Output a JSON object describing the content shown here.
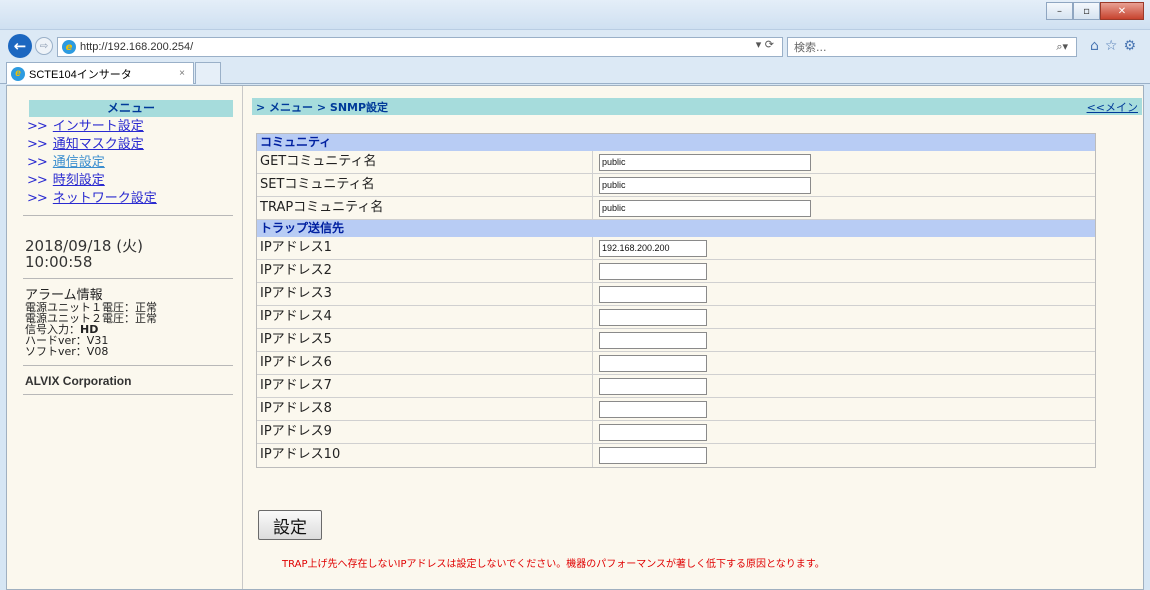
{
  "browser": {
    "url": "http://192.168.200.254/",
    "search_placeholder": "検索...",
    "tab_title": "SCTE104インサータ",
    "tab_close": "×",
    "address_tools": "▾ ⟳",
    "win_min": "–",
    "win_max": "▫",
    "win_close": "✕"
  },
  "sidebar": {
    "menu_title": "メニュー",
    "items": [
      {
        "arrow": ">>",
        "label": "インサート設定"
      },
      {
        "arrow": ">>",
        "label": "通知マスク設定"
      },
      {
        "arrow": ">>",
        "label": "通信設定"
      },
      {
        "arrow": ">>",
        "label": "時刻設定"
      },
      {
        "arrow": ">>",
        "label": "ネットワーク設定"
      }
    ],
    "date": "2018/09/18 (火)",
    "time": "10:00:58",
    "alarm": {
      "title": "アラーム情報",
      "psu1": "電源ユニット１電圧：正常",
      "psu2": "電源ユニット２電圧：正常",
      "signal_label": "信号入力：",
      "signal_value": "HD",
      "hard_ver": "ハードver：V31",
      "soft_ver": "ソフトver：V08"
    },
    "company": "ALVIX Corporation"
  },
  "content": {
    "breadcrumb": "> メニュー > SNMP設定",
    "main_link": "<<メイン",
    "community_header": "コミュニティ",
    "community_rows": [
      {
        "label": "GETコミュニティ名",
        "value": "public"
      },
      {
        "label": "SETコミュニティ名",
        "value": "public"
      },
      {
        "label": "TRAPコミュニティ名",
        "value": "public"
      }
    ],
    "trap_header": "トラップ送信先",
    "trap_rows": [
      {
        "label": "IPアドレス1",
        "value": "192.168.200.200"
      },
      {
        "label": "IPアドレス2",
        "value": ""
      },
      {
        "label": "IPアドレス3",
        "value": ""
      },
      {
        "label": "IPアドレス4",
        "value": ""
      },
      {
        "label": "IPアドレス5",
        "value": ""
      },
      {
        "label": "IPアドレス6",
        "value": ""
      },
      {
        "label": "IPアドレス7",
        "value": ""
      },
      {
        "label": "IPアドレス8",
        "value": ""
      },
      {
        "label": "IPアドレス9",
        "value": ""
      },
      {
        "label": "IPアドレス10",
        "value": ""
      }
    ],
    "submit_label": "設定",
    "warning": "TRAP上げ先へ存在しないIPアドレスは設定しないでください。機器のパフォーマンスが著しく低下する原因となります。"
  }
}
